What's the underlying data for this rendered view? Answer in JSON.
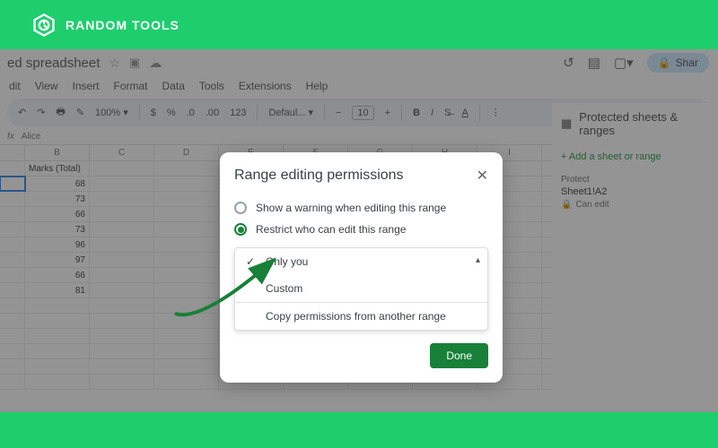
{
  "brand": {
    "name": "RANDOM TOOLS"
  },
  "doc": {
    "title": "ed spreadsheet"
  },
  "menus": [
    "dit",
    "View",
    "Insert",
    "Format",
    "Data",
    "Tools",
    "Extensions",
    "Help"
  ],
  "toolbar": {
    "zoom": "100%",
    "currency": "$",
    "percent": "%",
    "dec1": ".0",
    "dec2": ".00",
    "num": "123",
    "font": "Defaul...",
    "size": "10"
  },
  "share": "Shar",
  "fx": {
    "label": "fx",
    "value": "Alice"
  },
  "cols": [
    "B",
    "C",
    "D",
    "E",
    "F",
    "G",
    "H",
    "I"
  ],
  "header_cell": "Marks (Total)",
  "values": [
    "68",
    "73",
    "66",
    "73",
    "96",
    "97",
    "66",
    "81"
  ],
  "sidebar": {
    "title": "Protected sheets & ranges",
    "add": "+ Add a sheet or range",
    "protect": "Protect",
    "range": "Sheet1!A2",
    "can": "Can edit"
  },
  "dialog": {
    "title": "Range editing permissions",
    "opt1": "Show a warning when editing this range",
    "opt2": "Restrict who can edit this range",
    "dd1": "Only you",
    "dd2": "Custom",
    "dd3": "Copy permissions from another range",
    "done": "Done"
  }
}
